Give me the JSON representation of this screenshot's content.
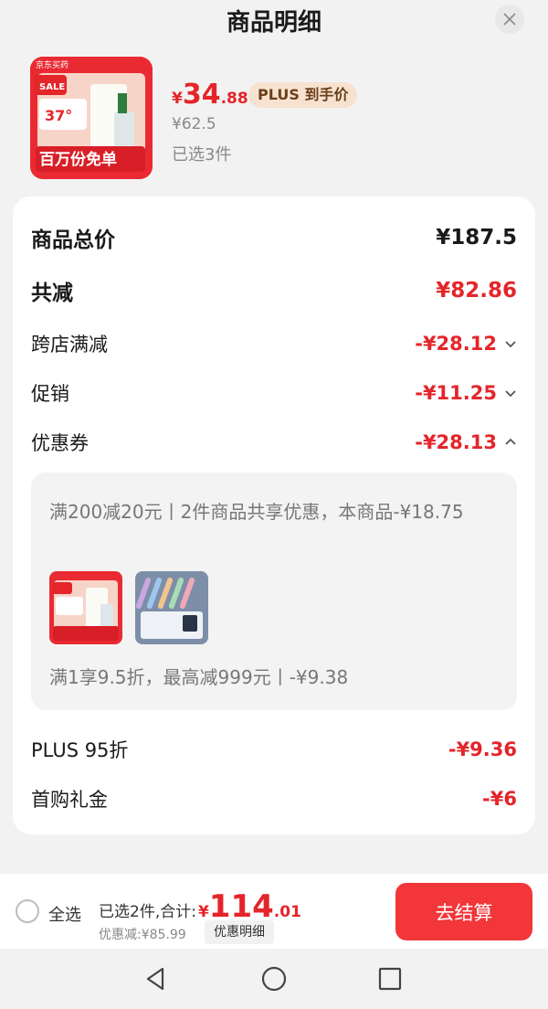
{
  "header": {
    "title": "商品明细"
  },
  "product": {
    "thumb": {
      "brand": "京东买药",
      "sale": "SALE",
      "promo": "百万份免单",
      "pct": "37°"
    },
    "price": {
      "yen": "¥",
      "int": "34",
      "dec": ".88"
    },
    "plus_label": "PLUS 到手价",
    "original_price": "¥62.5",
    "selected": "已选3件"
  },
  "summary": {
    "total": {
      "label": "商品总价",
      "value": "¥187.5"
    },
    "reduced": {
      "label": "共减",
      "value": "¥82.86"
    },
    "cross_store": {
      "label": "跨店满减",
      "value": "-¥28.12"
    },
    "promotion": {
      "label": "促销",
      "value": "-¥11.25"
    },
    "coupon": {
      "label": "优惠券",
      "value": "-¥28.13",
      "detail1": "满200减20元丨2件商品共享优惠，本商品-¥18.75",
      "detail2": "满1享9.5折，最高减999元丨-¥9.38"
    },
    "plus95": {
      "label": "PLUS 95折",
      "value": "-¥9.36"
    },
    "first_gift": {
      "label": "首购礼金",
      "value": "-¥6"
    }
  },
  "bottom": {
    "select_all": "全选",
    "total_label": "已选2件,合计:",
    "total_yen": "¥",
    "total_int": "114",
    "total_dec": ".01",
    "discount": "优惠减:¥85.99",
    "detail_button": "优惠明细",
    "checkout": "去结算"
  },
  "colors": {
    "accent": "#e4252a",
    "checkout": "#f2363a",
    "plus_badge": "#f6e2cf"
  }
}
